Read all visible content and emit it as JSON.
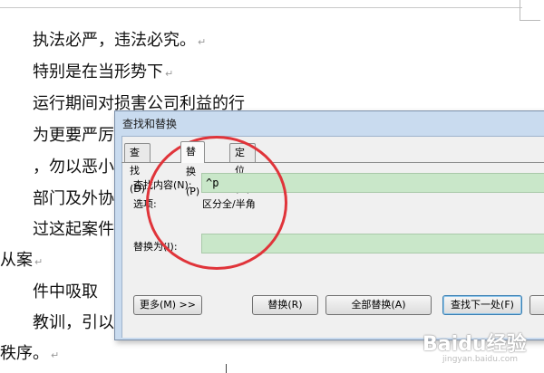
{
  "document": {
    "lines": [
      "执法必严，违法必究。",
      "特别是在当形势下",
      "运行期间对损害公司利益的行",
      "为更要严厉",
      "，勿以恶小",
      "部门及外协",
      "过这起案件",
      "从案",
      "件中吸取",
      "教训，引以",
      "秩序。"
    ],
    "paragraph_mark": "↵"
  },
  "dialog": {
    "title": "查找和替换",
    "tabs": [
      "查找(D)",
      "替换(P)",
      "定位(G)"
    ],
    "find_label": "查找内容(N):",
    "find_value": "^p",
    "options_label": "选项:",
    "options_value": "区分全/半角",
    "replace_label": "替换为(I):",
    "replace_value": "",
    "buttons": {
      "more": "更多(M) >>",
      "replace": "替换(R)",
      "replace_all": "全部替换(A)",
      "find_next": "查找下一处(F)"
    }
  },
  "watermark": {
    "brand": "Baidu经验",
    "url": "jingyan.baidu.com"
  },
  "colors": {
    "annotation_circle": "#e0343a",
    "field_highlight": "#c9e7c9",
    "dialog_frame": "#c9dbef"
  }
}
